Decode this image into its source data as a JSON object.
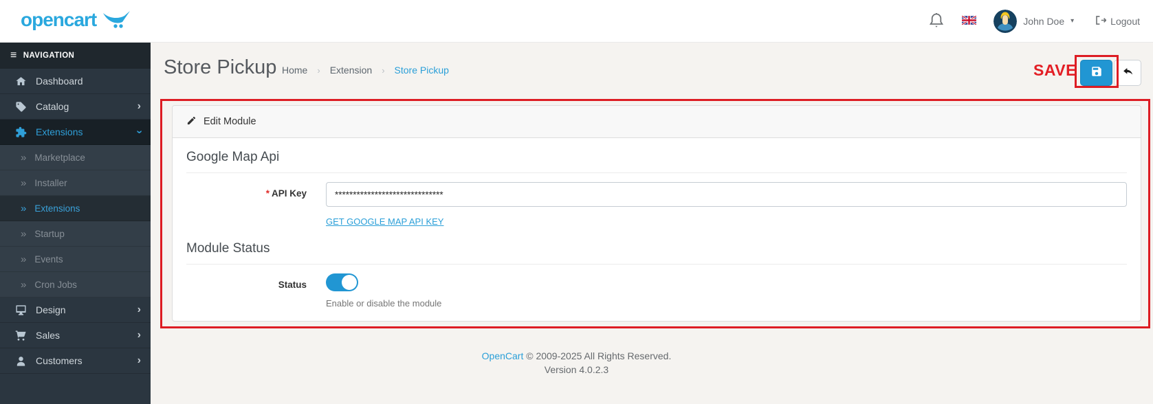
{
  "header": {
    "logo_text": "opencart",
    "user_name": "John Doe",
    "logout_label": "Logout"
  },
  "sidebar": {
    "nav_label": "NAVIGATION",
    "items": [
      {
        "label": "Dashboard"
      },
      {
        "label": "Catalog"
      },
      {
        "label": "Extensions"
      },
      {
        "label": "Design"
      },
      {
        "label": "Sales"
      },
      {
        "label": "Customers"
      }
    ],
    "submenu": [
      {
        "label": "Marketplace"
      },
      {
        "label": "Installer"
      },
      {
        "label": "Extensions"
      },
      {
        "label": "Startup"
      },
      {
        "label": "Events"
      },
      {
        "label": "Cron Jobs"
      }
    ]
  },
  "page": {
    "title": "Store Pickup",
    "breadcrumb": [
      "Home",
      "Extension",
      "Store Pickup"
    ],
    "save_annotation_label": "SAVE"
  },
  "panel": {
    "header_title": "Edit Module",
    "google_map_api": {
      "heading": "Google Map Api",
      "required_mark": "*",
      "api_key_label": "API Key",
      "api_key_value": "******************************",
      "get_key_link": "GET GOOGLE MAP API KEY"
    },
    "module_status": {
      "heading": "Module Status",
      "status_label": "Status",
      "enabled": true,
      "help_text": "Enable or disable the module"
    }
  },
  "footer": {
    "link_text": "OpenCart",
    "copyright": "© 2009-2025 All Rights Reserved.",
    "version": "Version 4.0.2.3"
  },
  "icons": {
    "menu": "≡",
    "submenu_marker": "»",
    "chevron_right": "›",
    "caret_down": "▾",
    "breadcrumb_separator": "›"
  },
  "colors": {
    "accent_blue": "#2196d3",
    "annotation_red": "#dd1c23",
    "save_text_red": "#e31e25",
    "sidebar_bg": "#2b3640",
    "link_blue": "#2a9fd8"
  }
}
